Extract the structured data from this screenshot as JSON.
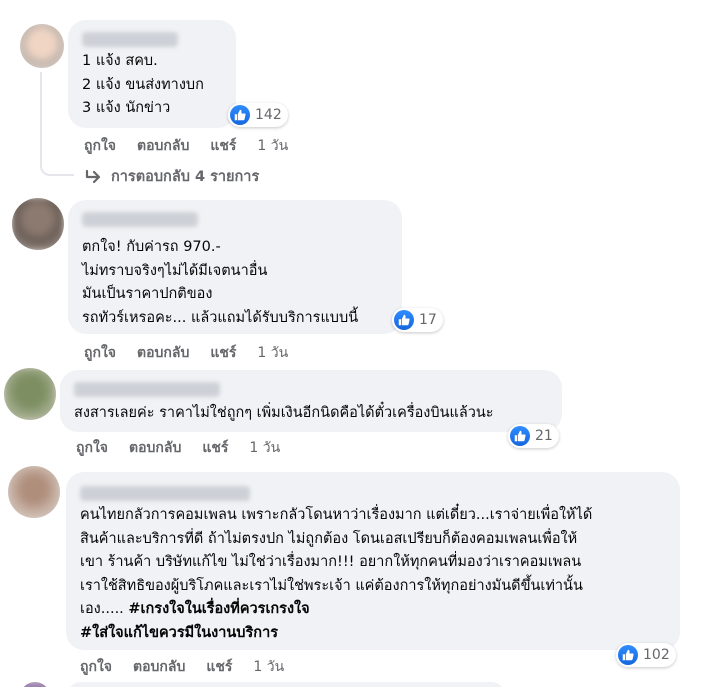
{
  "comments": [
    {
      "lines": [
        "1 แจ้ง สคบ.",
        "2 แจ้ง ขนส่งทางบก",
        "3 แจ้ง นักข่าว"
      ],
      "reactions": "142",
      "actions": {
        "like": "ถูกใจ",
        "reply": "ตอบกลับ",
        "share": "แชร์",
        "time": "1 วัน"
      },
      "replies_link": "การตอบกลับ 4 รายการ"
    },
    {
      "lines": [
        "ตกใจ! กับค่ารถ 970.-",
        "ไม่ทราบจริงๆไม่ได้มีเจตนาอื่น",
        "มันเป็นราคาปกติของ",
        "รถทัวร์เหรอคะ... แล้วแถมได้รับบริการแบบนี้"
      ],
      "reactions": "17",
      "actions": {
        "like": "ถูกใจ",
        "reply": "ตอบกลับ",
        "share": "แชร์",
        "time": "1 วัน"
      }
    },
    {
      "lines": [
        "สงสารเลยค่ะ ราคาไม่ใช่ถูกๆ เพิ่มเงินอีกนิดคือได้ตั๋วเครื่องบินแล้วนะ"
      ],
      "reactions": "21",
      "actions": {
        "like": "ถูกใจ",
        "reply": "ตอบกลับ",
        "share": "แชร์",
        "time": "1 วัน"
      }
    },
    {
      "lines": [
        "คนไทยกลัวการคอมเพลน เพราะกลัวโดนหาว่าเรื่องมาก แต่เดี๋ยว...เราจ่ายเพื่อให้ได้",
        "สินค้าและบริการที่ดี ถ้าไม่ตรงปก ไม่ถูกต้อง โดนเอสเปรียบก็ต้องคอมเพลนเพื่อให้",
        "เขา ร้านค้า บริษัทแก้ไข ไม่ใช่ว่าเรื่องมาก!!! อยากให้ทุกคนที่มองว่าเราคอมเพลน",
        "เราใช้สิทธิของผู้บริโภคและเราไม่ใช่พระเจ้า แค่ต้องการให้ทุกอย่างมันดีขึ้นเท่านั้น"
      ],
      "line5_prefix": "เอง..... ",
      "hashtag1": "#เกรงใจในเรื่องที่ควรเกรงใจ",
      "hashtag2": "#ใส่ใจแก้ไขควรมีในงานบริการ",
      "reactions": "102",
      "actions": {
        "like": "ถูกใจ",
        "reply": "ตอบกลับ",
        "share": "แชร์",
        "time": "1 วัน"
      }
    }
  ],
  "colors": {
    "bubble": "#f0f2f5",
    "meta": "#65676b",
    "like": "#1877f2"
  },
  "icons": {
    "like": "thumbs-up-icon",
    "reply_arrow": "reply-arrow-icon"
  }
}
